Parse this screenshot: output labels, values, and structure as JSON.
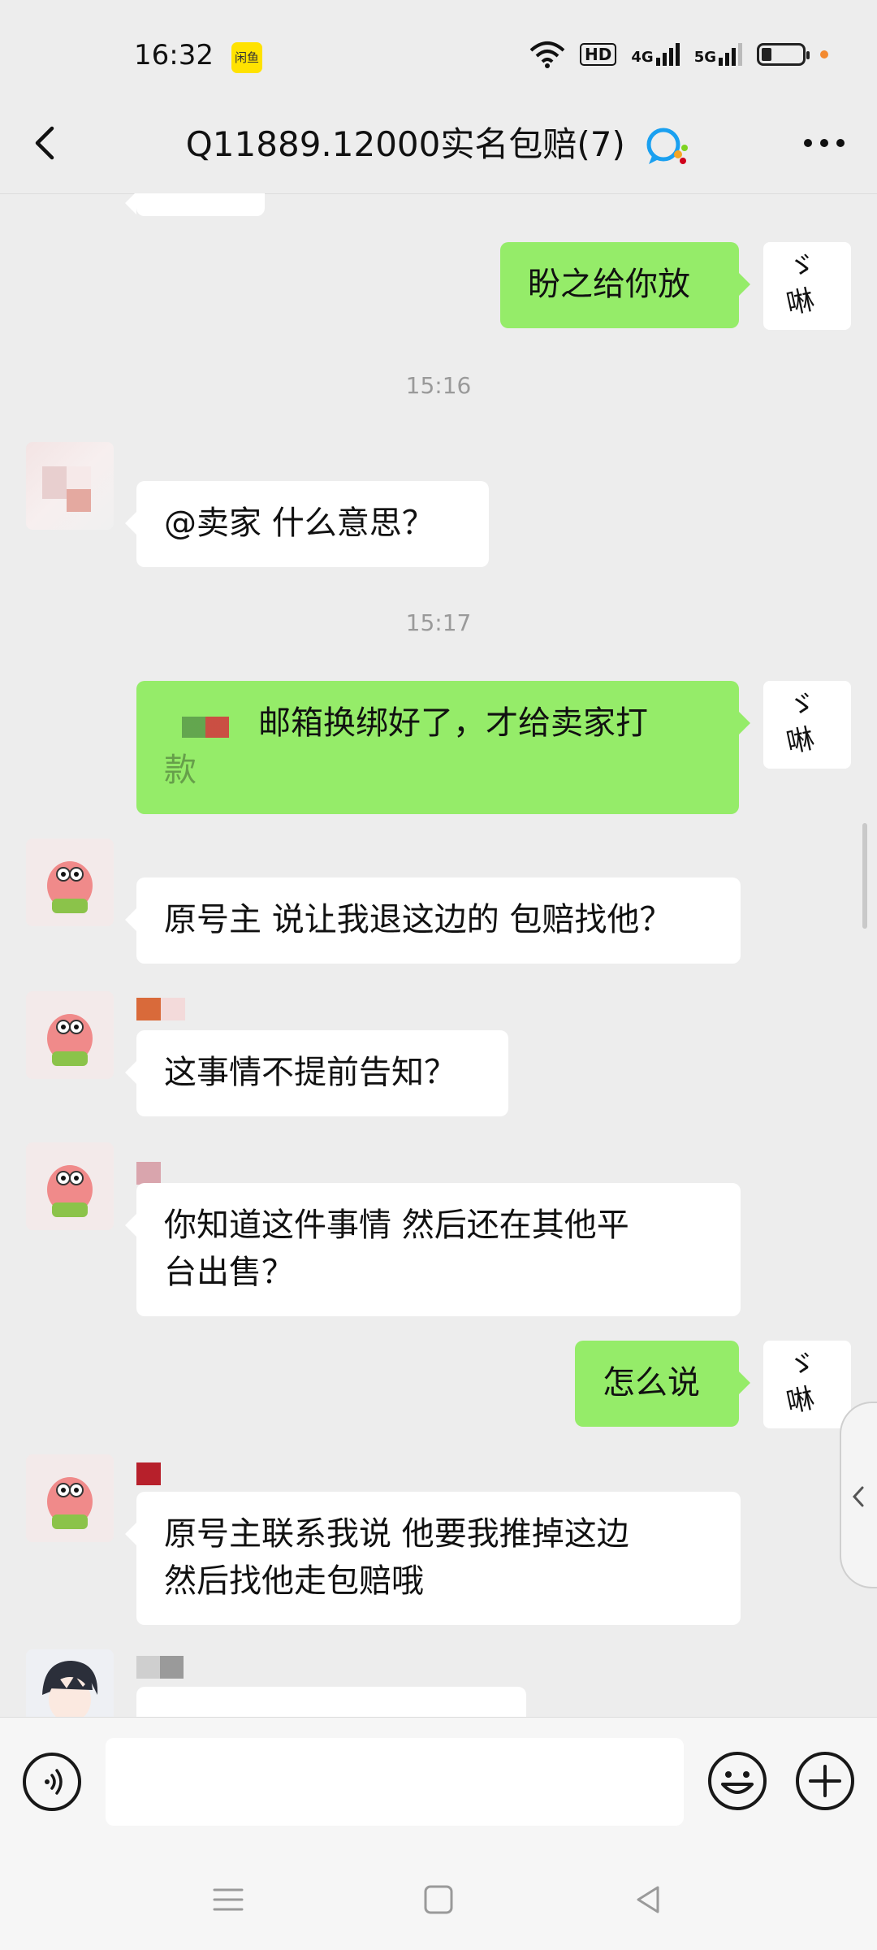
{
  "status_bar": {
    "time": "16:32",
    "app_badge": "闲鱼",
    "hd_label": "HD",
    "net1": "4G",
    "net2": "5G"
  },
  "header": {
    "title": "Q11889.12000实名包赔(7)",
    "back_icon": "back-arrow-icon",
    "more_icon": "more-dots-icon"
  },
  "messages": {
    "m1": "盼之给你放",
    "ts1": "15:16",
    "m2": "@卖家  什么意思？",
    "ts2": "15:17",
    "m3_line1": "邮箱换绑好了，才给卖家打",
    "m3_line2": "款",
    "m4": "原号主 说让我退这边的 包赔找他？",
    "m5": "这事情不提前告知？",
    "m6_line1": "你知道这件事情  然后还在其他平",
    "m6_line2": "台出售？",
    "m7": "怎么说",
    "m8_line1": "原号主联系我说  他要我推掉这边",
    "m8_line2": "然后找他走包赔哦"
  },
  "colors": {
    "sent_bubble": "#95ec69",
    "received_bubble": "#ffffff",
    "background": "#ededed"
  },
  "input": {
    "placeholder": ""
  }
}
